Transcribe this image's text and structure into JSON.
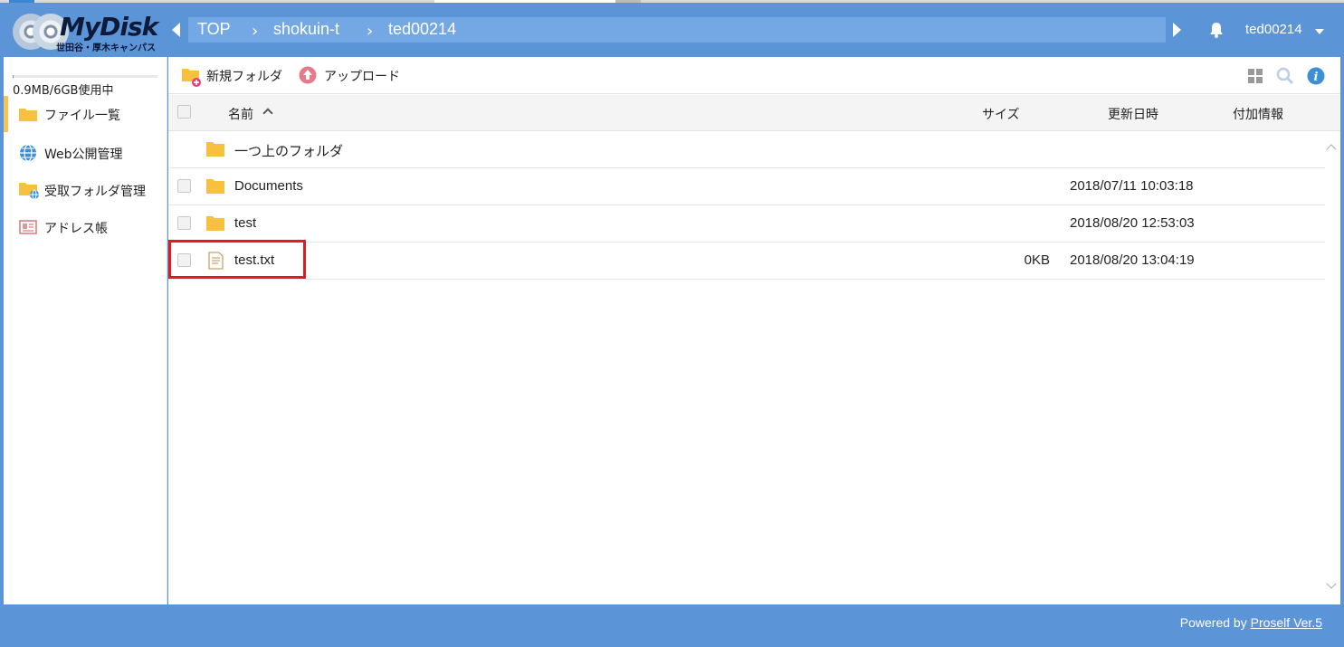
{
  "app": {
    "title": "MyDisk",
    "subtitle": "世田谷・厚木キャンパス"
  },
  "breadcrumb": {
    "items": [
      "TOP",
      "shokuin-t",
      "ted00214"
    ],
    "separator": "›"
  },
  "header": {
    "username": "ted00214"
  },
  "sidebar": {
    "usage": "0.9MB/6GB使用中",
    "items": [
      {
        "label": "ファイル一覧",
        "icon": "folder-icon",
        "active": true
      },
      {
        "label": "Web公開管理",
        "icon": "globe-icon",
        "active": false
      },
      {
        "label": "受取フォルダ管理",
        "icon": "folder-globe-icon",
        "active": false
      },
      {
        "label": "アドレス帳",
        "icon": "address-book-icon",
        "active": false
      }
    ]
  },
  "toolbar": {
    "new_folder_label": "新規フォルダ",
    "upload_label": "アップロード"
  },
  "table": {
    "headers": {
      "name": "名前",
      "size": "サイズ",
      "updated": "更新日時",
      "info": "付加情報"
    },
    "parent_label": "一つ上のフォルダ",
    "rows": [
      {
        "name": "Documents",
        "type": "folder",
        "size": "",
        "updated": "2018/07/11 10:03:18"
      },
      {
        "name": "test",
        "type": "folder",
        "size": "",
        "updated": "2018/08/20 12:53:03"
      },
      {
        "name": "test.txt",
        "type": "file",
        "size": "0KB",
        "updated": "2018/08/20 13:04:19"
      }
    ]
  },
  "footer": {
    "powered_prefix": "Powered by ",
    "powered_link": "Proself Ver.5"
  },
  "colors": {
    "brand_blue": "#5b95d8",
    "highlight_red": "#e21b23",
    "folder_yellow": "#f7c13f"
  }
}
